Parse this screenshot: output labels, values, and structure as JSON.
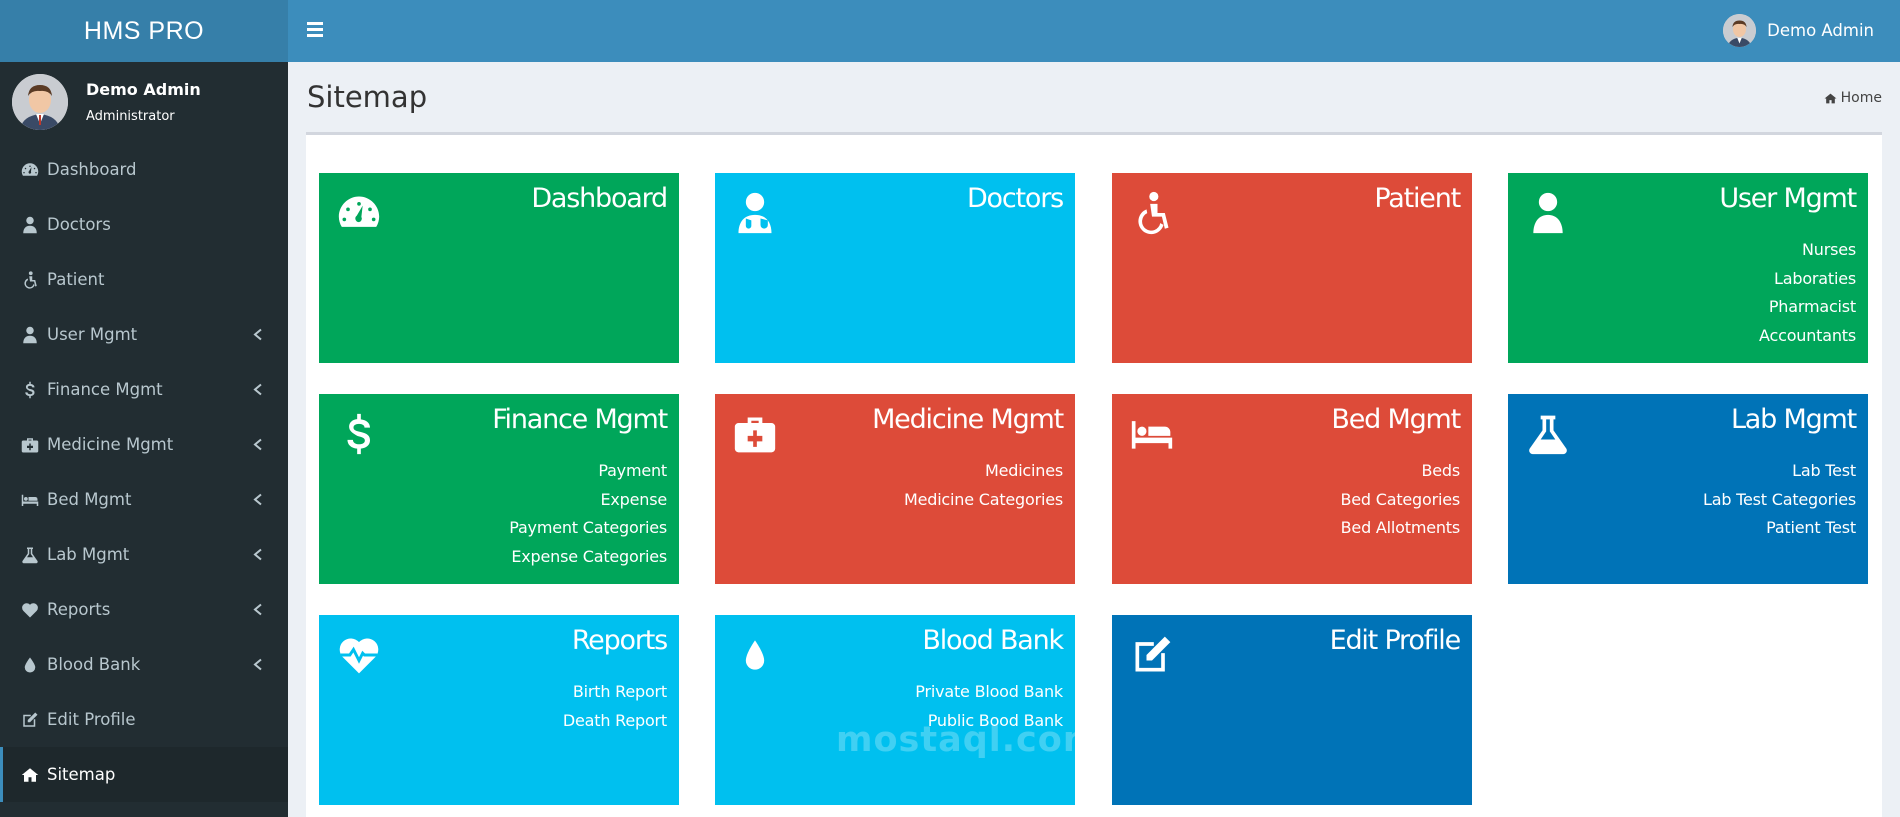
{
  "app": {
    "logo": "HMS PRO"
  },
  "user": {
    "name": "Demo Admin",
    "role": "Administrator"
  },
  "sidebar": {
    "items": [
      {
        "label": "Dashboard",
        "icon": "dashboard-icon",
        "expandable": false
      },
      {
        "label": "Doctors",
        "icon": "user-md-icon",
        "expandable": false
      },
      {
        "label": "Patient",
        "icon": "wheelchair-icon",
        "expandable": false
      },
      {
        "label": "User Mgmt",
        "icon": "user-icon",
        "expandable": true
      },
      {
        "label": "Finance Mgmt",
        "icon": "dollar-icon",
        "expandable": true
      },
      {
        "label": "Medicine Mgmt",
        "icon": "medkit-icon",
        "expandable": true
      },
      {
        "label": "Bed Mgmt",
        "icon": "bed-icon",
        "expandable": true
      },
      {
        "label": "Lab Mgmt",
        "icon": "flask-icon",
        "expandable": true
      },
      {
        "label": "Reports",
        "icon": "heartbeat-icon",
        "expandable": true
      },
      {
        "label": "Blood Bank",
        "icon": "tint-icon",
        "expandable": true
      },
      {
        "label": "Edit Profile",
        "icon": "edit-icon",
        "expandable": false
      },
      {
        "label": "Sitemap",
        "icon": "home-icon",
        "expandable": false,
        "active": true
      }
    ]
  },
  "header": {
    "user_name": "Demo Admin"
  },
  "page": {
    "title": "Sitemap",
    "breadcrumb": "Home"
  },
  "tiles": [
    {
      "title": "Dashboard",
      "color": "#00a65a",
      "icon": "dashboard-icon",
      "links": []
    },
    {
      "title": "Doctors",
      "color": "#00c0ef",
      "icon": "user-md-icon",
      "links": []
    },
    {
      "title": "Patient",
      "color": "#dd4b39",
      "icon": "wheelchair-icon",
      "links": []
    },
    {
      "title": "User Mgmt",
      "color": "#00a65a",
      "icon": "user-icon",
      "links": [
        "Nurses",
        "Laboraties",
        "Pharmacist",
        "Accountants"
      ]
    },
    {
      "title": "Finance Mgmt",
      "color": "#00a65a",
      "icon": "dollar-icon",
      "links": [
        "Payment",
        "Expense",
        "Payment Categories",
        "Expense Categories"
      ]
    },
    {
      "title": "Medicine Mgmt",
      "color": "#dd4b39",
      "icon": "medkit-icon",
      "links": [
        "Medicines",
        "Medicine Categories"
      ]
    },
    {
      "title": "Bed Mgmt",
      "color": "#dd4b39",
      "icon": "bed-icon",
      "links": [
        "Beds",
        "Bed Categories",
        "Bed Allotments"
      ]
    },
    {
      "title": "Lab Mgmt",
      "color": "#0073b7",
      "icon": "flask-icon",
      "links": [
        "Lab Test",
        "Lab Test Categories",
        "Patient Test"
      ]
    },
    {
      "title": "Reports",
      "color": "#00c0ef",
      "icon": "heartbeat-icon",
      "links": [
        "Birth Report",
        "Death Report"
      ]
    },
    {
      "title": "Blood Bank",
      "color": "#00c0ef",
      "icon": "tint-icon",
      "links": [
        "Private Blood Bank",
        "Public Bood Bank"
      ]
    },
    {
      "title": "Edit Profile",
      "color": "#0073b7",
      "icon": "edit-icon",
      "links": []
    }
  ],
  "watermark": "mostaql.com"
}
